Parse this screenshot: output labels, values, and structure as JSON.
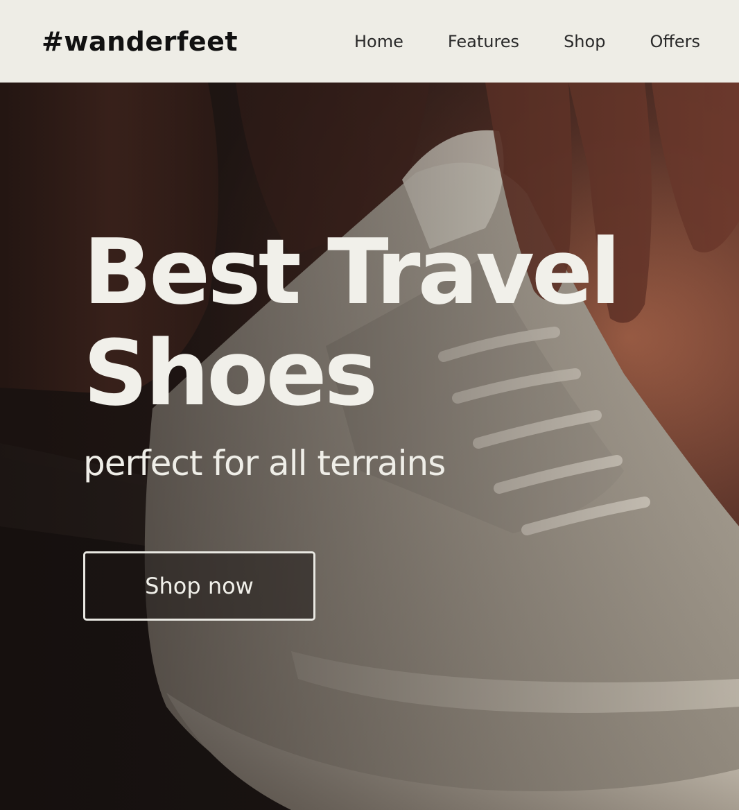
{
  "header": {
    "logo": "#wanderfeet",
    "nav": [
      {
        "label": "Home"
      },
      {
        "label": "Features"
      },
      {
        "label": "Shop"
      },
      {
        "label": "Offers"
      }
    ]
  },
  "hero": {
    "title_line1": "Best Travel",
    "title_line2": "Shoes",
    "subtitle": "perfect for all terrains",
    "cta_label": "Shop now",
    "image_subject": "hands-lacing-white-sneaker"
  },
  "colors": {
    "header_bg": "#eeede6",
    "hero_text": "#f1f0ea",
    "hero_dark": "#1e1917"
  }
}
